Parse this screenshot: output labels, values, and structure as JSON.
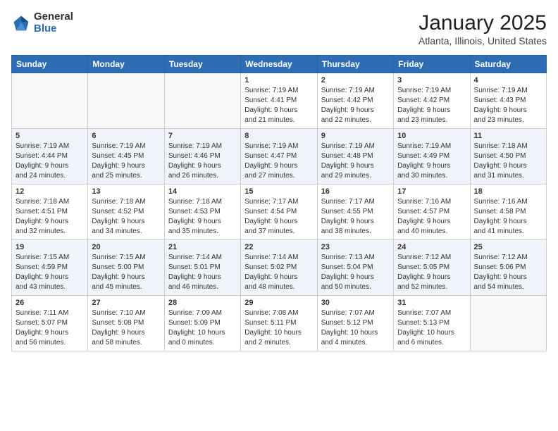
{
  "header": {
    "logo_general": "General",
    "logo_blue": "Blue",
    "month": "January 2025",
    "location": "Atlanta, Illinois, United States"
  },
  "weekdays": [
    "Sunday",
    "Monday",
    "Tuesday",
    "Wednesday",
    "Thursday",
    "Friday",
    "Saturday"
  ],
  "weeks": [
    [
      {
        "day": "",
        "info": ""
      },
      {
        "day": "",
        "info": ""
      },
      {
        "day": "",
        "info": ""
      },
      {
        "day": "1",
        "info": "Sunrise: 7:19 AM\nSunset: 4:41 PM\nDaylight: 9 hours\nand 21 minutes."
      },
      {
        "day": "2",
        "info": "Sunrise: 7:19 AM\nSunset: 4:42 PM\nDaylight: 9 hours\nand 22 minutes."
      },
      {
        "day": "3",
        "info": "Sunrise: 7:19 AM\nSunset: 4:42 PM\nDaylight: 9 hours\nand 23 minutes."
      },
      {
        "day": "4",
        "info": "Sunrise: 7:19 AM\nSunset: 4:43 PM\nDaylight: 9 hours\nand 23 minutes."
      }
    ],
    [
      {
        "day": "5",
        "info": "Sunrise: 7:19 AM\nSunset: 4:44 PM\nDaylight: 9 hours\nand 24 minutes."
      },
      {
        "day": "6",
        "info": "Sunrise: 7:19 AM\nSunset: 4:45 PM\nDaylight: 9 hours\nand 25 minutes."
      },
      {
        "day": "7",
        "info": "Sunrise: 7:19 AM\nSunset: 4:46 PM\nDaylight: 9 hours\nand 26 minutes."
      },
      {
        "day": "8",
        "info": "Sunrise: 7:19 AM\nSunset: 4:47 PM\nDaylight: 9 hours\nand 27 minutes."
      },
      {
        "day": "9",
        "info": "Sunrise: 7:19 AM\nSunset: 4:48 PM\nDaylight: 9 hours\nand 29 minutes."
      },
      {
        "day": "10",
        "info": "Sunrise: 7:19 AM\nSunset: 4:49 PM\nDaylight: 9 hours\nand 30 minutes."
      },
      {
        "day": "11",
        "info": "Sunrise: 7:18 AM\nSunset: 4:50 PM\nDaylight: 9 hours\nand 31 minutes."
      }
    ],
    [
      {
        "day": "12",
        "info": "Sunrise: 7:18 AM\nSunset: 4:51 PM\nDaylight: 9 hours\nand 32 minutes."
      },
      {
        "day": "13",
        "info": "Sunrise: 7:18 AM\nSunset: 4:52 PM\nDaylight: 9 hours\nand 34 minutes."
      },
      {
        "day": "14",
        "info": "Sunrise: 7:18 AM\nSunset: 4:53 PM\nDaylight: 9 hours\nand 35 minutes."
      },
      {
        "day": "15",
        "info": "Sunrise: 7:17 AM\nSunset: 4:54 PM\nDaylight: 9 hours\nand 37 minutes."
      },
      {
        "day": "16",
        "info": "Sunrise: 7:17 AM\nSunset: 4:55 PM\nDaylight: 9 hours\nand 38 minutes."
      },
      {
        "day": "17",
        "info": "Sunrise: 7:16 AM\nSunset: 4:57 PM\nDaylight: 9 hours\nand 40 minutes."
      },
      {
        "day": "18",
        "info": "Sunrise: 7:16 AM\nSunset: 4:58 PM\nDaylight: 9 hours\nand 41 minutes."
      }
    ],
    [
      {
        "day": "19",
        "info": "Sunrise: 7:15 AM\nSunset: 4:59 PM\nDaylight: 9 hours\nand 43 minutes."
      },
      {
        "day": "20",
        "info": "Sunrise: 7:15 AM\nSunset: 5:00 PM\nDaylight: 9 hours\nand 45 minutes."
      },
      {
        "day": "21",
        "info": "Sunrise: 7:14 AM\nSunset: 5:01 PM\nDaylight: 9 hours\nand 46 minutes."
      },
      {
        "day": "22",
        "info": "Sunrise: 7:14 AM\nSunset: 5:02 PM\nDaylight: 9 hours\nand 48 minutes."
      },
      {
        "day": "23",
        "info": "Sunrise: 7:13 AM\nSunset: 5:04 PM\nDaylight: 9 hours\nand 50 minutes."
      },
      {
        "day": "24",
        "info": "Sunrise: 7:12 AM\nSunset: 5:05 PM\nDaylight: 9 hours\nand 52 minutes."
      },
      {
        "day": "25",
        "info": "Sunrise: 7:12 AM\nSunset: 5:06 PM\nDaylight: 9 hours\nand 54 minutes."
      }
    ],
    [
      {
        "day": "26",
        "info": "Sunrise: 7:11 AM\nSunset: 5:07 PM\nDaylight: 9 hours\nand 56 minutes."
      },
      {
        "day": "27",
        "info": "Sunrise: 7:10 AM\nSunset: 5:08 PM\nDaylight: 9 hours\nand 58 minutes."
      },
      {
        "day": "28",
        "info": "Sunrise: 7:09 AM\nSunset: 5:09 PM\nDaylight: 10 hours\nand 0 minutes."
      },
      {
        "day": "29",
        "info": "Sunrise: 7:08 AM\nSunset: 5:11 PM\nDaylight: 10 hours\nand 2 minutes."
      },
      {
        "day": "30",
        "info": "Sunrise: 7:07 AM\nSunset: 5:12 PM\nDaylight: 10 hours\nand 4 minutes."
      },
      {
        "day": "31",
        "info": "Sunrise: 7:07 AM\nSunset: 5:13 PM\nDaylight: 10 hours\nand 6 minutes."
      },
      {
        "day": "",
        "info": ""
      }
    ]
  ]
}
